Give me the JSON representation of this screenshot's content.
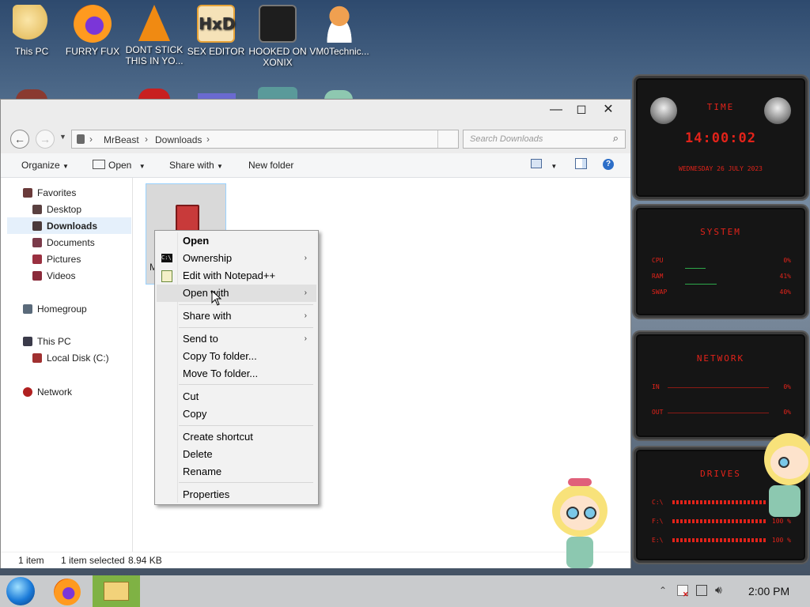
{
  "desktop": {
    "icons": [
      {
        "label": "This PC",
        "color": "#e8c36a"
      },
      {
        "label": "FURRY FUX",
        "color": "#e66000"
      },
      {
        "label": "DONT STICK THIS IN YO...",
        "color": "#f08a12"
      },
      {
        "label": "SEX EDITOR",
        "color": "#e7a338"
      },
      {
        "label": "HOOKED ON XONIX",
        "color": "#1e1e1e"
      },
      {
        "label": "VM0Technic...",
        "color": "#f0a050"
      }
    ]
  },
  "explorer": {
    "window_buttons": {
      "minimize": "—",
      "maximize": "◻",
      "close": "✕"
    },
    "nav": {
      "back_icon": "back-arrow-icon",
      "forward_icon": "forward-arrow-icon",
      "recent_icon": "chevron-down-icon"
    },
    "address": {
      "crumbs": [
        "MrBeast",
        "Downloads"
      ],
      "separator": "›"
    },
    "search": {
      "placeholder": "Search Downloads",
      "icon": "search-icon"
    },
    "toolbar": {
      "organize": "Organize",
      "open": "Open",
      "share_with": "Share with",
      "new_folder": "New folder"
    },
    "sidebar": {
      "favorites": "Favorites",
      "favorites_items": [
        "Desktop",
        "Downloads",
        "Documents",
        "Pictures",
        "Videos"
      ],
      "homegroup": "Homegroup",
      "this_pc": "This PC",
      "this_pc_items": [
        "Local Disk (C:)"
      ],
      "network": "Network",
      "selected": "Downloads"
    },
    "file": {
      "label_visible": "M"
    },
    "status": {
      "count": "1 item",
      "selection": "1 item selected",
      "size": "8.94 KB"
    }
  },
  "context_menu": {
    "items": [
      {
        "label": "Open",
        "bold": true
      },
      {
        "label": "Ownership",
        "submenu": true,
        "icon": "cmd-icon"
      },
      {
        "label": "Edit with Notepad++",
        "icon": "notepad-plus-plus-icon"
      },
      {
        "label": "Open with",
        "submenu": true,
        "hovered": true
      },
      {
        "label": "Share with",
        "submenu": true
      },
      {
        "label": "Send to",
        "submenu": true
      },
      {
        "label": "Copy To folder..."
      },
      {
        "label": "Move To folder..."
      },
      {
        "label": "Cut"
      },
      {
        "label": "Copy"
      },
      {
        "label": "Create shortcut"
      },
      {
        "label": "Delete"
      },
      {
        "label": "Rename"
      },
      {
        "label": "Properties"
      }
    ],
    "submenu_arrow": "›"
  },
  "gadget": {
    "time_title": "TIME",
    "time": "14:00:02",
    "date": "WEDNESDAY 26 JULY 2023",
    "system_title": "SYSTEM",
    "system_rows": [
      {
        "label": "CPU",
        "value": "0%"
      },
      {
        "label": "RAM",
        "value": "41%"
      },
      {
        "label": "SWAP",
        "value": "40%"
      }
    ],
    "network_title": "NETWORK",
    "network_rows": [
      {
        "label": "IN",
        "value": "0%"
      },
      {
        "label": "OUT",
        "value": "0%"
      }
    ],
    "drives_title": "DRIVES",
    "drive_rows": [
      {
        "label": "C:\\",
        "value": ""
      },
      {
        "label": "F:\\",
        "value": "100 %"
      },
      {
        "label": "E:\\",
        "value": "100 %"
      }
    ],
    "accent": "#e2231a"
  },
  "taskbar": {
    "clock": "2:00 PM",
    "tray_icons": [
      "show-hidden-icons-icon",
      "action-center-flag-icon",
      "network-icon",
      "volume-icon"
    ]
  }
}
